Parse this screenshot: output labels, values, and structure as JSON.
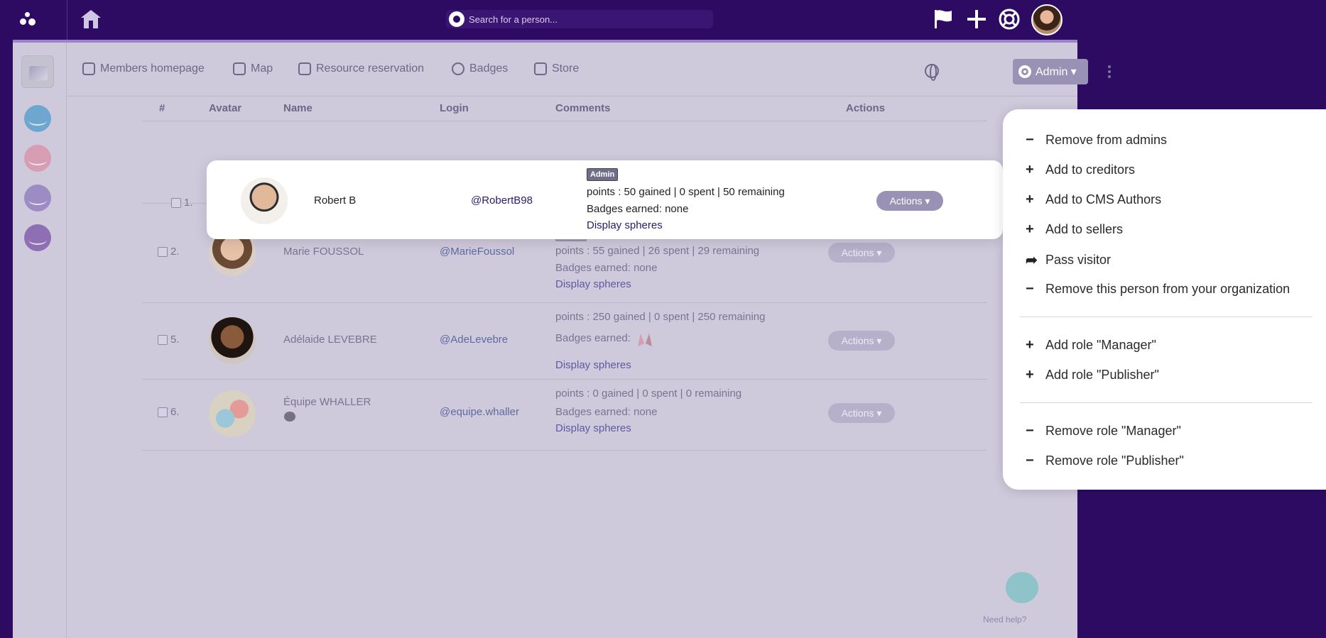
{
  "search": {
    "placeholder": "Search for a person..."
  },
  "nav": {
    "items": [
      {
        "label": "Members homepage",
        "icon": "shield-icon"
      },
      {
        "label": "Map",
        "icon": "map-icon"
      },
      {
        "label": "Resource reservation",
        "icon": "calendar-icon"
      },
      {
        "label": "Badges",
        "icon": "badge-icon"
      },
      {
        "label": "Store",
        "icon": "store-icon"
      }
    ],
    "admin_label": "Admin ▾"
  },
  "table": {
    "headers": [
      "#",
      "Avatar",
      "Name",
      "Login",
      "Comments",
      "Actions"
    ],
    "rows": [
      {
        "num": "1.",
        "name": "Robert B",
        "login": "@RobertB98",
        "tags": [
          "Admin"
        ],
        "points": "points : 50 gained | 0 spent | 50 remaining",
        "badges": "Badges earned: none",
        "spheres": "Display spheres",
        "actions": "Actions ▾"
      },
      {
        "num": "2.",
        "name": "Marie FOUSSOL",
        "login": "@MarieFoussol",
        "tags": [
          "Me",
          "Admin"
        ],
        "points": "points : 55 gained | 26 spent | 29 remaining",
        "badges": "Badges earned: none",
        "spheres": "Display spheres",
        "actions": "Actions ▾"
      },
      {
        "num": "5.",
        "name": "Adélaide LEVEBRE",
        "login": "@AdeLevebre",
        "tags": [],
        "points": "points : 250 gained | 0 spent | 250 remaining",
        "badges": "Badges earned:",
        "spheres": "Display spheres",
        "actions": "Actions ▾"
      },
      {
        "num": "6.",
        "name": "Équipe WHALLER",
        "login": "@equipe.whaller",
        "tags": [],
        "points": "points : 0 gained | 0 spent | 0 remaining",
        "badges": "Badges earned: none",
        "spheres": "Display spheres",
        "actions": "Actions ▾"
      }
    ]
  },
  "help": {
    "label": "Need help?"
  },
  "menu": {
    "group1": [
      {
        "icon": "minus-icon",
        "label": "Remove from admins"
      },
      {
        "icon": "plus-icon",
        "label": "Add to creditors"
      },
      {
        "icon": "plus-icon",
        "label": "Add to CMS Authors"
      },
      {
        "icon": "plus-icon",
        "label": "Add to sellers"
      },
      {
        "icon": "share-icon",
        "label": "Pass visitor"
      },
      {
        "icon": "minus-icon",
        "label": "Remove this person from your organization"
      }
    ],
    "group2": [
      {
        "icon": "plus-icon",
        "label": "Add role \"Manager\""
      },
      {
        "icon": "plus-icon",
        "label": "Add role \"Publisher\""
      }
    ],
    "group3": [
      {
        "icon": "minus-icon",
        "label": "Remove role \"Manager\""
      },
      {
        "icon": "minus-icon",
        "label": "Remove role \"Publisher\""
      }
    ]
  }
}
